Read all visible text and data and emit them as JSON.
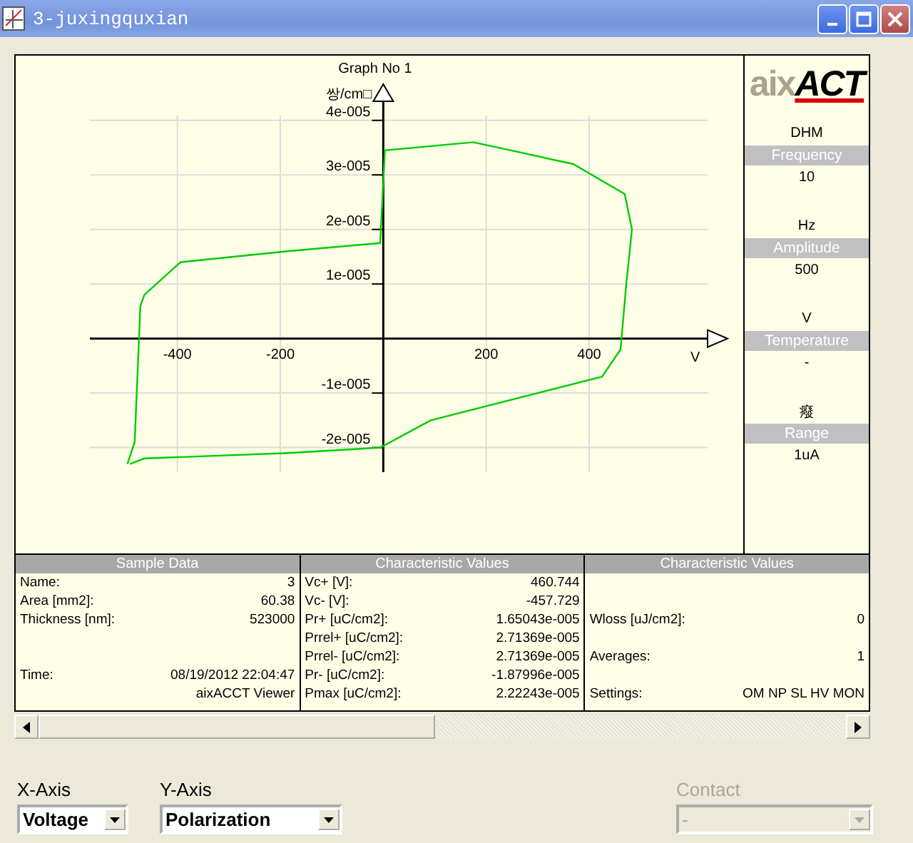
{
  "window": {
    "title": "3-juxingquxian"
  },
  "graph": {
    "chart_data": {
      "type": "line",
      "title": "Graph No 1",
      "xlabel": "V",
      "ylabel": "쌍/cm□",
      "x": [
        -497,
        -483,
        -472,
        -464,
        -394,
        -186,
        -6,
        3,
        175,
        369,
        469,
        483,
        472,
        461,
        425,
        92,
        -6,
        -186,
        -464,
        -492
      ],
      "series": [
        {
          "color": "#00cc00",
          "values": [
            -2.3e-05,
            -1.9e-05,
            6e-06,
            8e-06,
            1.4e-05,
            1.6e-05,
            1.75e-05,
            3.45e-05,
            3.6e-05,
            3.2e-05,
            2.65e-05,
            2e-05,
            1e-05,
            -2e-06,
            -7e-06,
            -1.5e-05,
            -2e-05,
            -2.1e-05,
            -2.2e-05,
            -2.3e-05
          ]
        }
      ],
      "xlim": [
        -570,
        630
      ],
      "ylim": [
        -2.45e-05,
        4.35e-05
      ],
      "grid": true,
      "xticks": [
        -400,
        -200,
        200,
        400
      ],
      "yticks": [
        {
          "value": 4e-05,
          "label": "4e-005"
        },
        {
          "value": 3e-05,
          "label": "3e-005"
        },
        {
          "value": 2e-05,
          "label": "2e-005"
        },
        {
          "value": 1e-05,
          "label": "1e-005"
        },
        {
          "value": -1e-05,
          "label": "-1e-005"
        },
        {
          "value": -2e-05,
          "label": "-2e-005"
        }
      ]
    }
  },
  "sidebar": {
    "logo": {
      "part_1": "aix",
      "part_2": "ACT"
    },
    "mode": "DHM",
    "params": [
      {
        "label": "Frequency",
        "value": "10",
        "unit": "Hz"
      },
      {
        "label": "Amplitude",
        "value": "500",
        "unit": "V"
      },
      {
        "label": "Temperature",
        "value": "-",
        "unit": "癈"
      },
      {
        "label": "Range",
        "value": "1uA"
      }
    ]
  },
  "tables": [
    {
      "title": "Sample Data",
      "rows": [
        {
          "kind": "field",
          "label": "Name:",
          "value": "3"
        },
        {
          "kind": "field",
          "label": "Area [mm2]:",
          "value": "60.38"
        },
        {
          "kind": "field",
          "label": "Thickness [nm]:",
          "value": "523000"
        },
        {
          "kind": "empty"
        },
        {
          "kind": "empty"
        },
        {
          "kind": "field",
          "label": "Time:",
          "value": "08/19/2012 22:04:47"
        },
        {
          "kind": "value",
          "value": "aixACCT Viewer"
        }
      ]
    },
    {
      "title": "Characteristic Values",
      "rows": [
        {
          "kind": "field",
          "label": "Vc+ [V]:",
          "value": "460.744"
        },
        {
          "kind": "field",
          "label": "Vc- [V]:",
          "value": "-457.729"
        },
        {
          "kind": "field",
          "label": "Pr+ [uC/cm2]:",
          "value": "1.65043e-005"
        },
        {
          "kind": "field",
          "label": "Prrel+ [uC/cm2]:",
          "value": "2.71369e-005"
        },
        {
          "kind": "field",
          "label": "Prrel- [uC/cm2]:",
          "value": "2.71369e-005"
        },
        {
          "kind": "field",
          "label": "Pr- [uC/cm2]:",
          "value": "-1.87996e-005"
        },
        {
          "kind": "field",
          "label": "Pmax [uC/cm2]:",
          "value": "2.22243e-005"
        }
      ]
    },
    {
      "title": "Characteristic Values",
      "rows": [
        {
          "kind": "empty"
        },
        {
          "kind": "empty"
        },
        {
          "kind": "field",
          "label": "Wloss [uJ/cm2]:",
          "value": "0"
        },
        {
          "kind": "empty"
        },
        {
          "kind": "field",
          "label": "Averages:",
          "value": "1"
        },
        {
          "kind": "empty"
        },
        {
          "kind": "field",
          "label": "Settings:",
          "value": "OM NP SL HV MON"
        }
      ]
    }
  ],
  "controls": [
    {
      "label": "X-Axis",
      "value": "Voltage",
      "disabled": false
    },
    {
      "label": "Y-Axis",
      "value": "Polarization",
      "disabled": false
    },
    {
      "label": "Contact",
      "value": "-",
      "disabled": true
    }
  ]
}
